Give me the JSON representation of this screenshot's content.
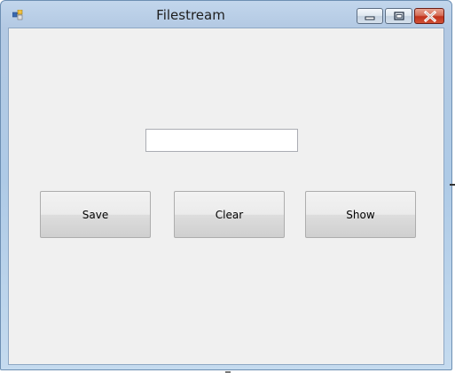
{
  "window": {
    "title": "Filestream",
    "icon": "winforms-app-icon",
    "controls": {
      "minimize_icon": "minimize-icon",
      "maximize_icon": "maximize-icon",
      "close_icon": "close-icon",
      "close_color": "#c0331d"
    }
  },
  "form": {
    "text_input": {
      "value": "",
      "placeholder": ""
    },
    "buttons": {
      "save_label": "Save",
      "clear_label": "Clear",
      "show_label": "Show"
    }
  },
  "colors": {
    "form_background": "#f0f0f0",
    "title_bar": "#b3c9e3",
    "button_border": "#adadad"
  }
}
